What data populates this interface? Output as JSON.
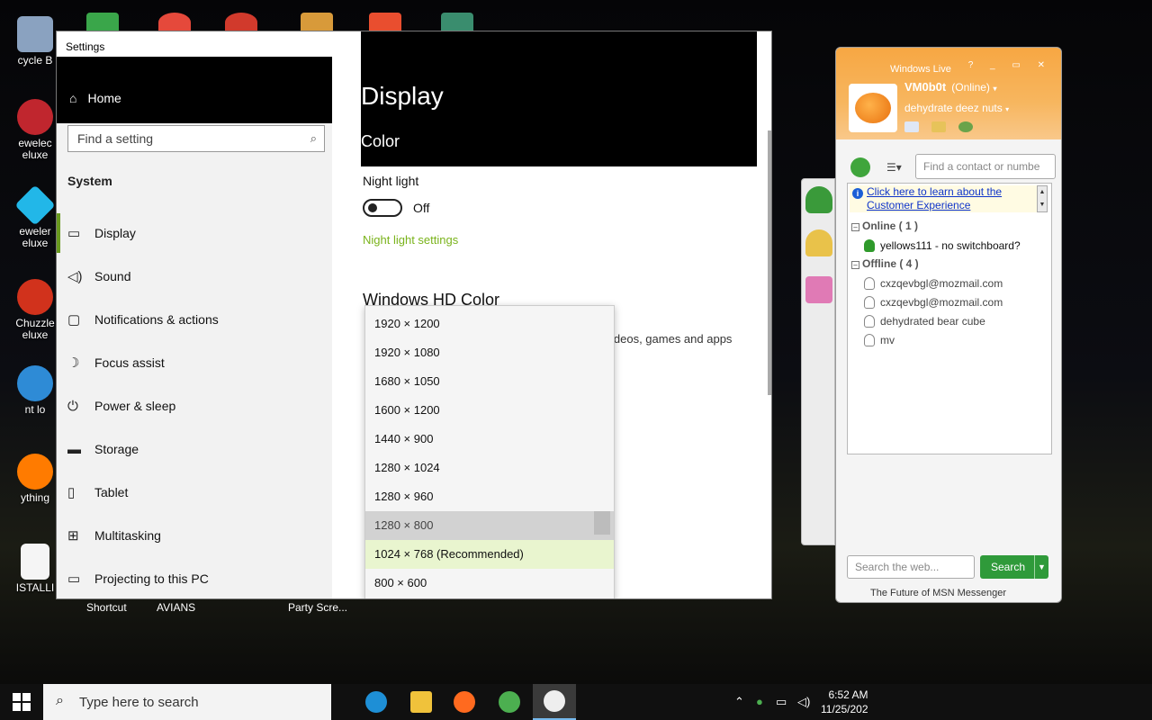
{
  "desktop": {
    "icons": [
      {
        "label": "cycle B",
        "color": "#8aa2c0"
      },
      {
        "label": "ewelec\neluxe",
        "color": "#c0262e"
      },
      {
        "label": "eweler\neluxe",
        "color": "#22b7e8"
      },
      {
        "label": "Chuzzle\neluxe",
        "color": "#d1321c"
      },
      {
        "label": "nt lo",
        "color": "#2e8bd6"
      },
      {
        "label": "ything",
        "color": "#ff7b00"
      },
      {
        "label": "ISTALLI",
        "color": "#f5f5f5"
      }
    ],
    "shortcuts": [
      "Shortcut",
      "AVIANS",
      "Party Scre..."
    ]
  },
  "settings": {
    "window_title": "Settings",
    "controls": {
      "minimize": "—",
      "maximize": "▭",
      "close": "✕"
    },
    "home_label": "Home",
    "search_placeholder": "Find a setting",
    "section": "System",
    "nav": [
      {
        "icon": "monitor-icon",
        "glyph": "▭",
        "label": "Display"
      },
      {
        "icon": "speaker-icon",
        "glyph": "🔈",
        "label": "Sound"
      },
      {
        "icon": "notification-icon",
        "glyph": "▢",
        "label": "Notifications & actions"
      },
      {
        "icon": "moon-icon",
        "glyph": "☽",
        "label": "Focus assist"
      },
      {
        "icon": "power-icon",
        "glyph": "⏻",
        "label": "Power & sleep"
      },
      {
        "icon": "storage-icon",
        "glyph": "▬",
        "label": "Storage"
      },
      {
        "icon": "tablet-icon",
        "glyph": "▯",
        "label": "Tablet"
      },
      {
        "icon": "multitask-icon",
        "glyph": "⊞",
        "label": "Multitasking"
      },
      {
        "icon": "projector-icon",
        "glyph": "▭",
        "label": "Projecting to this PC"
      }
    ],
    "page_title": "Display",
    "color_heading": "Color",
    "night_light_label": "Night light",
    "toggle_state": "Off",
    "night_light_link": "Night light settings",
    "hd_heading": "Windows HD Color",
    "hd_text": "ideos, games and apps",
    "resolutions": [
      "1920 × 1200",
      "1920 × 1080",
      "1680 × 1050",
      "1600 × 1200",
      "1440 × 900",
      "1280 × 1024",
      "1280 × 960",
      "1280 × 800",
      "1024 × 768 (Recommended)",
      "800 × 600"
    ],
    "selected_resolution": "1280 × 800",
    "recommended_resolution": "1024 × 768 (Recommended)"
  },
  "msn": {
    "app_title": "Windows Live",
    "window_controls": "? _ ▭ ✕",
    "user_name": "VM0b0t",
    "user_status": "(Online)",
    "personal_message": "dehydrate deez nuts",
    "contact_search_placeholder": "Find a contact or numbe",
    "banner_text": "Click here to learn about the Customer Experience",
    "online_group": "Online ( 1 )",
    "offline_group": "Offline ( 4 )",
    "online_contacts": [
      "yellows111 - no switchboard?"
    ],
    "offline_contacts": [
      "cxzqevbgl@mozmail.com",
      "cxzqevbgl@mozmail.com",
      "dehydrated bear cube",
      "mv"
    ],
    "web_search_placeholder": "Search the web...",
    "search_button": "Search",
    "footer": "The Future of MSN Messenger",
    "accent": "#f7a743"
  },
  "taskbar": {
    "search_placeholder": "Type here to search",
    "apps": [
      {
        "name": "edge",
        "color": "#1e8fd6"
      },
      {
        "name": "file-explorer",
        "color": "#f0c23b"
      },
      {
        "name": "firefox",
        "color": "#ff6a1f"
      },
      {
        "name": "messenger",
        "color": "#4caf50"
      },
      {
        "name": "settings",
        "color": "#eeeeee"
      }
    ],
    "time": "6:52 AM",
    "date": "11/25/202"
  }
}
